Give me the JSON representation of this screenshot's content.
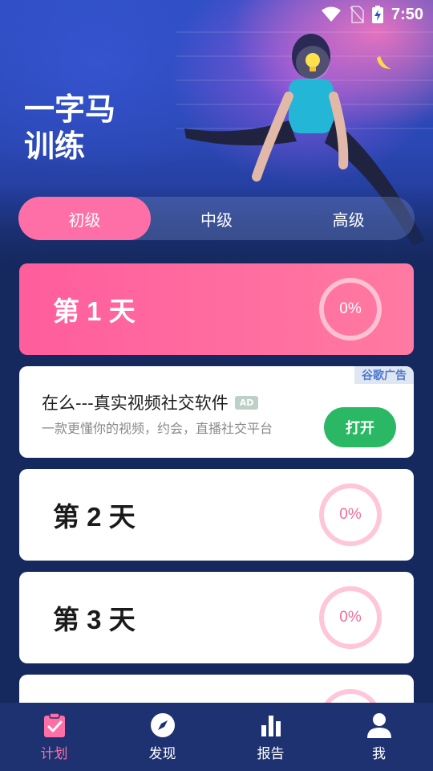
{
  "status_bar": {
    "time": "7:50"
  },
  "header": {
    "title_line1": "一字马",
    "title_line2": "训练"
  },
  "level_tabs": [
    {
      "label": "初级",
      "active": true
    },
    {
      "label": "中级",
      "active": false
    },
    {
      "label": "高级",
      "active": false
    }
  ],
  "days": [
    {
      "label": "第 1 天",
      "progress": "0%"
    },
    {
      "label": "第 2 天",
      "progress": "0%"
    },
    {
      "label": "第 3 天",
      "progress": "0%"
    }
  ],
  "ad": {
    "tag": "谷歌广告",
    "title": "在么---真实视频社交软件",
    "badge": "AD",
    "description": "一款更懂你的视频，约会，直播社交平台",
    "button": "打开"
  },
  "bottom_nav": [
    {
      "label": "计划",
      "icon": "clipboard-check-icon"
    },
    {
      "label": "发现",
      "icon": "compass-icon"
    },
    {
      "label": "报告",
      "icon": "bar-chart-icon"
    },
    {
      "label": "我",
      "icon": "person-icon"
    }
  ],
  "colors": {
    "accent": "#ff6fa7",
    "background": "#16295e",
    "ad_button": "#2bb865"
  }
}
